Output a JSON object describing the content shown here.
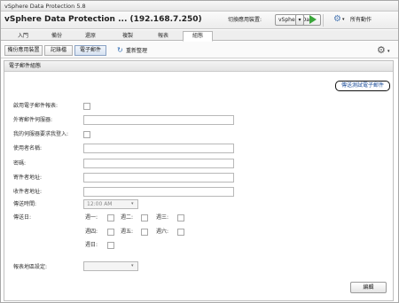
{
  "window": {
    "app_title": "vSphere Data Protection 5.8",
    "header_title": "vSphere Data Protection ... (192.168.7.250)",
    "switch_label": "切換應用裝置:",
    "appliance_value": "vSphere Da...",
    "actions_label": "所有動作"
  },
  "tabs": [
    {
      "label": "入門"
    },
    {
      "label": "備份"
    },
    {
      "label": "還原"
    },
    {
      "label": "複製"
    },
    {
      "label": "報表"
    },
    {
      "label": "組態"
    }
  ],
  "subtabs": [
    {
      "label": "備份應用裝置"
    },
    {
      "label": "記錄檔"
    },
    {
      "label": "電子郵件"
    }
  ],
  "refresh_label": "重新整理",
  "panel": {
    "title": "電子郵件組態",
    "send_test_label": "傳送測試電子郵件",
    "labels": {
      "enable": "啟用電子郵件報表:",
      "smtp": "外寄郵件伺服器:",
      "auth": "我的伺服器要求我登入:",
      "username": "使用者名稱:",
      "password": "密碼:",
      "from": "寄件者地址:",
      "to": "收件者地址:",
      "send_time": "傳送時間:",
      "send_day": "傳送日:",
      "locale": "報表地區設定:"
    },
    "send_time_value": "12:00 AM",
    "days": [
      "週一:",
      "週二:",
      "週三:",
      "週四:",
      "週五:",
      "週六:",
      "週日:"
    ],
    "edit_label": "編輯"
  }
}
